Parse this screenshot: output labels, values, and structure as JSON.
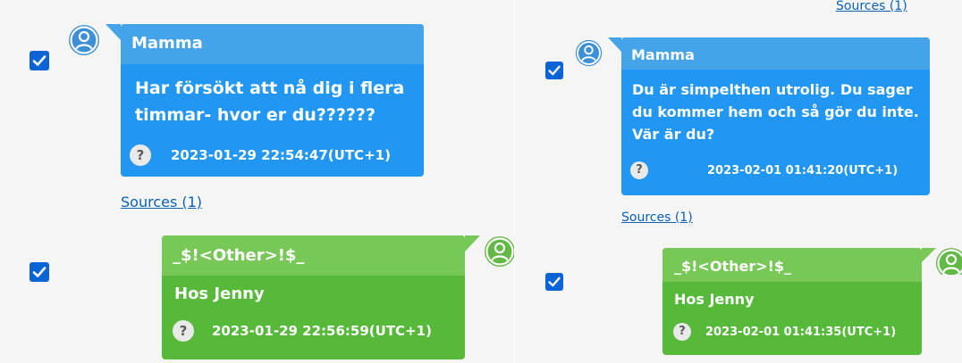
{
  "left": {
    "msg1": {
      "sender": "Mamma",
      "text": "Har försökt att nå dig i flera timmar- hvor er du??????",
      "timestamp": "2023-01-29 22:54:47(UTC+1)",
      "help": "?",
      "sources": "Sources (1)"
    },
    "msg2": {
      "sender": "_$!<Other>!$_",
      "text": "Hos Jenny",
      "timestamp": "2023-01-29 22:56:59(UTC+1)",
      "help": "?"
    }
  },
  "right": {
    "top_sources": "Sources (1)",
    "msg1": {
      "sender": "Mamma",
      "text": "Du är simpelthen utrolig. Du sager du kommer hem och så gör du inte. Vär är du?",
      "timestamp": "2023-02-01 01:41:20(UTC+1)",
      "help": "?",
      "sources": "Sources (1)"
    },
    "msg2": {
      "sender": "_$!<Other>!$_",
      "text": "Hos Jenny",
      "timestamp": "2023-02-01 01:41:35(UTC+1)",
      "help": "?"
    }
  },
  "colors": {
    "blue_header": "#45a4e9",
    "blue_body": "#2196f3",
    "green_header": "#78c857",
    "green_body": "#57b93a",
    "checkbox": "#0a64d6",
    "link": "#0a61b5"
  }
}
